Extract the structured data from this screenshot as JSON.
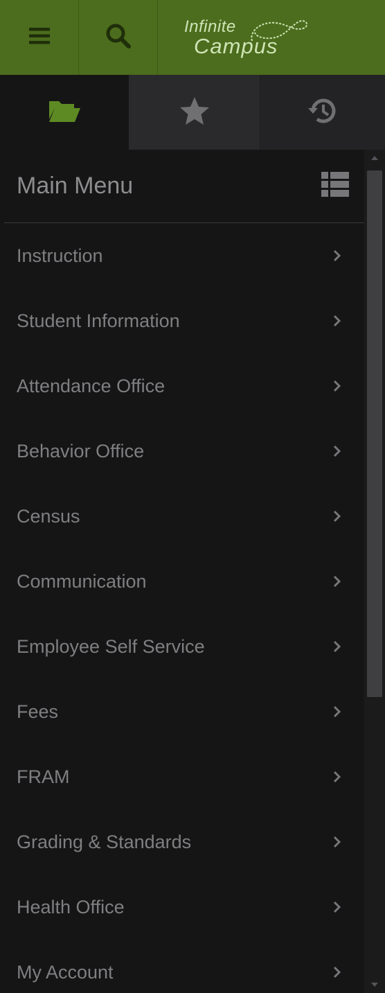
{
  "topbar": {
    "menu_icon": "hamburger-icon",
    "search_icon": "search-icon",
    "logo": {
      "line1": "Infinite",
      "line2": "Campus"
    }
  },
  "tabs": [
    {
      "icon": "folder-open-icon",
      "active": true
    },
    {
      "icon": "star-icon",
      "active": false
    },
    {
      "icon": "history-icon",
      "active": false
    }
  ],
  "panel": {
    "title": "Main Menu",
    "view_icon": "list-view-icon",
    "items": [
      {
        "label": "Instruction"
      },
      {
        "label": "Student Information"
      },
      {
        "label": "Attendance Office"
      },
      {
        "label": "Behavior Office"
      },
      {
        "label": "Census"
      },
      {
        "label": "Communication"
      },
      {
        "label": "Employee Self Service"
      },
      {
        "label": "Fees"
      },
      {
        "label": "FRAM"
      },
      {
        "label": "Grading & Standards"
      },
      {
        "label": "Health Office"
      },
      {
        "label": "My Account"
      }
    ]
  },
  "colors": {
    "brand_green": "#4c6d1d",
    "active_icon_green": "#5e8a23",
    "background": "#151516",
    "text_gray": "#7f7f82"
  }
}
